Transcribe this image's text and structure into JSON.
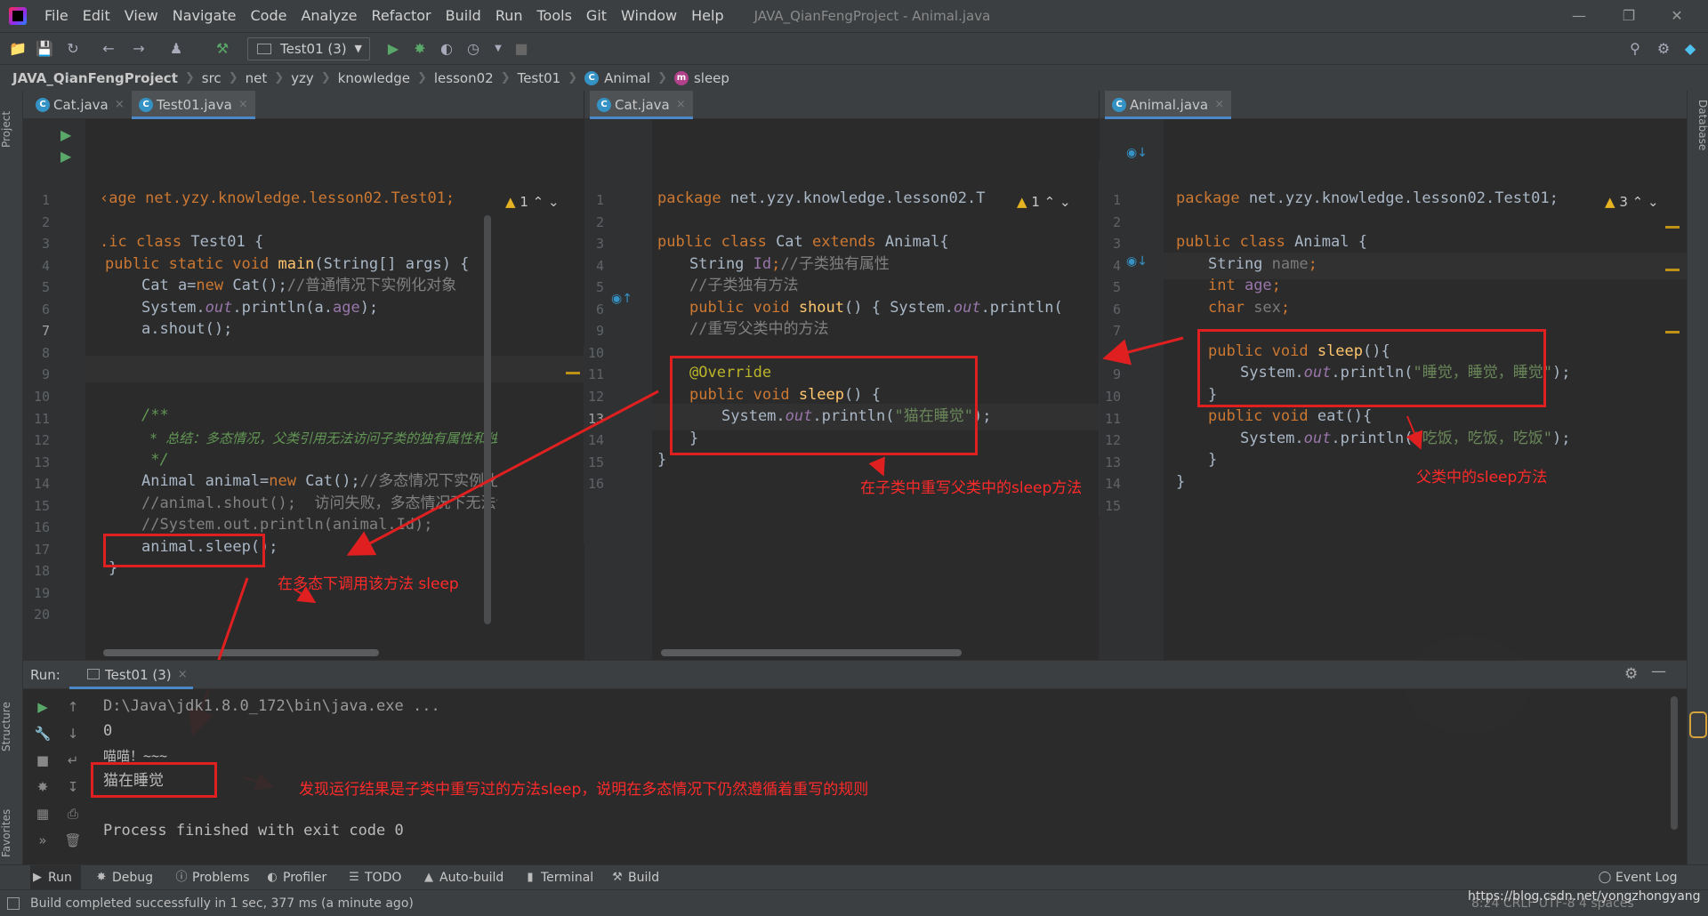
{
  "menubar": {
    "items": [
      "File",
      "Edit",
      "View",
      "Navigate",
      "Code",
      "Analyze",
      "Refactor",
      "Build",
      "Run",
      "Tools",
      "Git",
      "Window",
      "Help"
    ],
    "window_title": "JAVA_QianFengProject - Animal.java"
  },
  "toolbar": {
    "run_config": "Test01 (3)"
  },
  "breadcrumb": [
    "JAVA_QianFengProject",
    "src",
    "net",
    "yzy",
    "knowledge",
    "lesson02",
    "Test01",
    "Animal",
    "sleep"
  ],
  "side_tabs": {
    "project": "Project",
    "structure": "Structure",
    "favorites": "Favorites",
    "database": "Database"
  },
  "left_pane": {
    "tabs": [
      "Cat.java",
      "Test01.java"
    ],
    "warnings": "1",
    "line_numbers": [
      "1",
      "2",
      "3",
      "4",
      "5",
      "6",
      "7",
      "8",
      "9",
      "10",
      "11",
      "12",
      "13",
      "14",
      "15",
      "16",
      "17",
      "18",
      "19",
      "20"
    ],
    "lines": {
      "l1": "‹age net.yzy.knowledge.lesson02.Test01;",
      "l3a": ".ic class ",
      "l3b": "Test01 {",
      "l4a": "public static void ",
      "l4b": "main",
      "l4c": "(String[] args) {",
      "l5a": "Cat a=",
      "l5b": "new ",
      "l5c": "Cat();",
      "l5d": "//普通情况下实例化对象",
      "l6a": "System.",
      "l6b": "out",
      "l6c": ".println(a.",
      "l6d": "age",
      "l6e": ");",
      "l7": "a.shout();",
      "l11": "/**",
      "l12": " * 总结：多态情况，父类引用无法访问子类的独有属性和独有方法",
      "l13": " */",
      "l14a": "Animal animal=",
      "l14b": "new ",
      "l14c": "Cat();",
      "l14d": "//多态情况下实例化对象",
      "l15": "//animal.shout();  访问失败，多态情况下无法访问到子类独有的方法",
      "l16": "//System.out.println(animal.Id);",
      "l17": "animal.sleep();",
      "l18": "}"
    }
  },
  "middle_pane": {
    "tabs": [
      "Cat.java"
    ],
    "warnings": "1",
    "line_numbers": [
      "1",
      "2",
      "3",
      "4",
      "5",
      "6",
      "9",
      "10",
      "11",
      "12",
      "13",
      "14",
      "15",
      "16"
    ],
    "lines": {
      "l1a": "package ",
      "l1b": "net.yzy.knowledge.lesson02.T",
      "l3a": "public class ",
      "l3b": "Cat ",
      "l3c": "extends ",
      "l3d": "Animal{",
      "l4a": "String ",
      "l4b": "Id",
      "l4c": ";",
      "l4d": "//子类独有属性",
      "l5": "//子类独有方法",
      "l6a": "public void ",
      "l6b": "shout",
      "l6c": "() { System.",
      "l6d": "out",
      "l6e": ".println(",
      "l9": "//重写父类中的方法",
      "l11": "@Override",
      "l12a": "public void ",
      "l12b": "sleep",
      "l12c": "() {",
      "l13a": "System.",
      "l13b": "out",
      "l13c": ".println(",
      "l13d": "\"猫在睡觉\"",
      "l13e": ");",
      "l14": "}",
      "l15": "}"
    }
  },
  "right_pane": {
    "tabs": [
      "Animal.java"
    ],
    "warnings": "3",
    "line_numbers": [
      "1",
      "2",
      "3",
      "4",
      "5",
      "6",
      "7",
      "8",
      "9",
      "10",
      "11",
      "12",
      "13",
      "14",
      "15"
    ],
    "lines": {
      "l1a": "package ",
      "l1b": "net.yzy.knowledge.lesson02.Test01;",
      "l3a": "public class ",
      "l3b": "Animal {",
      "l4a": "String ",
      "l4b": "name",
      "l4c": ";",
      "l5a": "int ",
      "l5b": "age",
      "l5c": ";",
      "l6a": "char ",
      "l6b": "sex",
      "l6c": ";",
      "l8a": "public void ",
      "l8b": "sleep",
      "l8c": "(){",
      "l9a": "System.",
      "l9b": "out",
      "l9c": ".println(",
      "l9d": "\"睡觉，睡觉，睡觉\"",
      "l9e": ");",
      "l10": "}",
      "l11a": "public void ",
      "l11b": "eat",
      "l11c": "(){",
      "l12a": "System.",
      "l12b": "out",
      "l12c": ".println(",
      "l12d": "\"吃饭，吃饭，吃饭\"",
      "l12e": ");",
      "l13": "}",
      "l14": "}"
    }
  },
  "annotations": {
    "call_note": "在多态下调用该方法 sleep",
    "override_note": "在子类中重写父类中的sleep方法",
    "parent_note": "父类中的sleep方法",
    "result_note": "发现运行结果是子类中重写过的方法sleep，说明在多态情况下仍然遵循着重写的规则"
  },
  "run_panel": {
    "label": "Run:",
    "tab": "Test01 (3)",
    "output": [
      "D:\\Java\\jdk1.8.0_172\\bin\\java.exe ...",
      "0",
      "喵喵！~~~",
      "猫在睡觉",
      "",
      "Process finished with exit code 0"
    ]
  },
  "bottom_tools": [
    "Run",
    "Debug",
    "Problems",
    "Profiler",
    "TODO",
    "Auto-build",
    "Terminal",
    "Build"
  ],
  "event_log": "Event Log",
  "status": {
    "message": "Build completed successfully in 1 sec, 377 ms (a minute ago)",
    "watermark": "https://blog.csdn.net/yongzhongyang",
    "right_info": "8:24  CRLF  UTF-8  4 spaces"
  }
}
